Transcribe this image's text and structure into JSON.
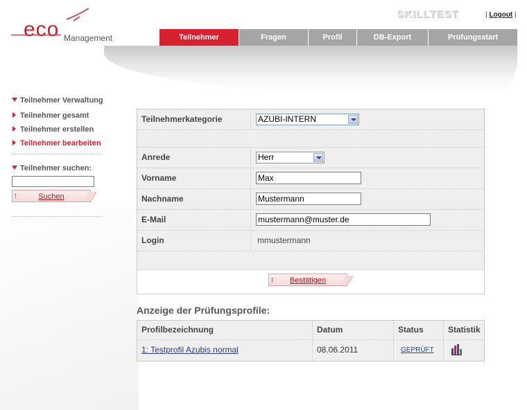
{
  "brand": {
    "logo_eco": "eco",
    "logo_management": "Management",
    "product": "SKILLTEST",
    "brand_color": "#d7212f"
  },
  "toplinks": {
    "sep_left": "|",
    "logout": "Logout",
    "sep_right": "|"
  },
  "nav": {
    "tabs": [
      {
        "label": "Teilnehmer",
        "active": true
      },
      {
        "label": "Fragen"
      },
      {
        "label": "Profil"
      },
      {
        "label": "DB-Export"
      },
      {
        "label": "Prüfungsstart"
      }
    ]
  },
  "sidebar": {
    "section_title": "Teilnehmer Verwaltung",
    "items": [
      {
        "label": "Teilnehmer gesamt"
      },
      {
        "label": "Teilnehmer erstellen"
      },
      {
        "label": "Teilnehmer bearbeiten",
        "active": true
      }
    ],
    "search_title": "Teilnehmer suchen:",
    "search_value": "",
    "search_button": "Suchen"
  },
  "form": {
    "category_label": "Teilnehmerkategorie",
    "category_value": "AZUBI-INTERN",
    "salutation_label": "Anrede",
    "salutation_value": "Herr",
    "firstname_label": "Vorname",
    "firstname_value": "Max",
    "lastname_label": "Nachname",
    "lastname_value": "Mustermann",
    "email_label": "E-Mail",
    "email_value": "mustermann@muster.de",
    "login_label": "Login",
    "login_value": "mmustermann",
    "confirm_button": "Bestätigen"
  },
  "profiles": {
    "title": "Anzeige der Prüfungsprofile:",
    "columns": [
      "Profilbezeichnung",
      "Datum",
      "Status",
      "Statistik"
    ],
    "rows": [
      {
        "name": "1: Testprofil Azubis normal",
        "date": "08.06.2011",
        "status": "GEPRÜFT",
        "stat_icon": "bar-chart-icon"
      }
    ]
  }
}
